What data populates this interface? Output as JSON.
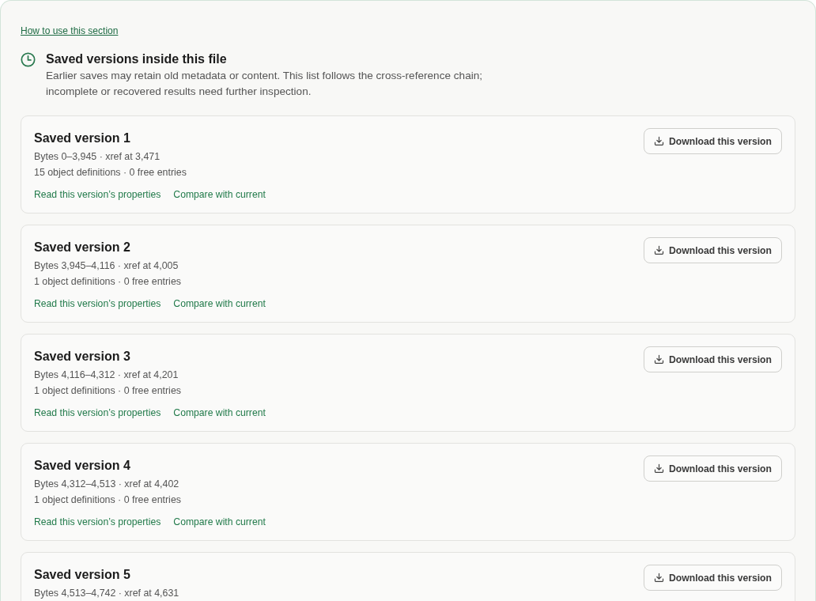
{
  "help_link": "How to use this section",
  "section": {
    "title": "Saved versions inside this file",
    "description": "Earlier saves may retain old metadata or content. This list follows the cross-reference chain; incomplete or recovered results need further inspection."
  },
  "versions": [
    {
      "title": "Saved version 1",
      "byte_range": "Bytes 0–3,945 · xref at 3,471",
      "counts": "15 object definitions · 0 free entries",
      "links": [
        "Read this version’s properties",
        "Compare with current"
      ],
      "button": "Download this version"
    },
    {
      "title": "Saved version 2",
      "byte_range": "Bytes 3,945–4,116 · xref at 4,005",
      "counts": "1 object definitions · 0 free entries",
      "links": [
        "Read this version’s properties",
        "Compare with current"
      ],
      "button": "Download this version"
    },
    {
      "title": "Saved version 3",
      "byte_range": "Bytes 4,116–4,312 · xref at 4,201",
      "counts": "1 object definitions · 0 free entries",
      "links": [
        "Read this version’s properties",
        "Compare with current"
      ],
      "button": "Download this version"
    },
    {
      "title": "Saved version 4",
      "byte_range": "Bytes 4,312–4,513 · xref at 4,402",
      "counts": "1 object definitions · 0 free entries",
      "links": [
        "Read this version’s properties",
        "Compare with current"
      ],
      "button": "Download this version"
    },
    {
      "title": "Saved version 5",
      "byte_range": "Bytes 4,513–4,742 · xref at 4,631",
      "button": "Download this version"
    }
  ]
}
